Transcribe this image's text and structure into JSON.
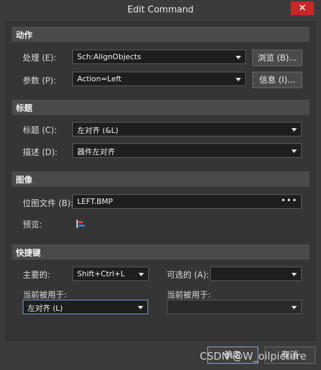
{
  "window": {
    "title": "Edit Command",
    "close_label": "✕"
  },
  "sections": {
    "action": "动作",
    "caption": "标题",
    "image": "图像",
    "shortcut": "快捷键"
  },
  "action": {
    "process_label": "处理 (E):",
    "process_value": "Sch:AlignObjects",
    "browse_button": "浏览 (B)...",
    "params_label": "参数 (P):",
    "params_value": "Action=Left",
    "info_button": "信息 (I)..."
  },
  "caption": {
    "title_label": "标题 (C):",
    "title_value": "左对齐 (&L)",
    "desc_label": "描述 (D):",
    "desc_value": "器件左对齐"
  },
  "image": {
    "bitmap_label": "位图文件 (B):",
    "bitmap_value": "LEFT.BMP",
    "bitmap_more": "•••",
    "preview_label": "预览:",
    "preview_icon": "align-left-icon"
  },
  "shortcut": {
    "primary_label": "主要的:",
    "primary_value": "Shift+Ctrl+L",
    "alternative_label": "可选的 (A):",
    "alternative_value": "",
    "current_used_label_1": "当前被用于:",
    "current_used_value_1": "左对齐 (L)",
    "current_used_label_2": "当前被用于:",
    "current_used_value_2": ""
  },
  "footer": {
    "ok_button": "确定",
    "cancel_button": "取消",
    "watermark": "CSDN @W_oilpicture"
  },
  "colors": {
    "background": "#3b3b3b",
    "close": "#c9262a",
    "focus_border": "#7aa0d4"
  }
}
